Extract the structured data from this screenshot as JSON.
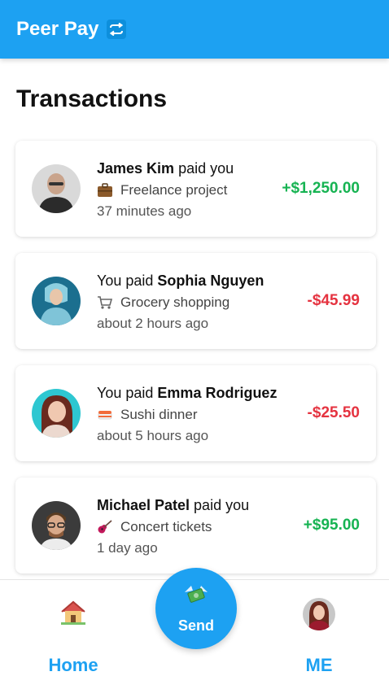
{
  "header": {
    "app_name": "Peer Pay",
    "icon": "swap-arrows-icon",
    "color": "#1da1f2"
  },
  "page": {
    "title": "Transactions"
  },
  "transactions": [
    {
      "prefix": "",
      "name": "James Kim",
      "suffix": " paid you",
      "category_icon": "briefcase-icon",
      "description": "Freelance project",
      "time": "37 minutes ago",
      "amount": "+$1,250.00",
      "amount_color": "#16b352"
    },
    {
      "prefix": "You paid ",
      "name": "Sophia Nguyen",
      "suffix": "",
      "category_icon": "shopping-cart-icon",
      "description": "Grocery shopping",
      "time": "about 2 hours ago",
      "amount": "-$45.99",
      "amount_color": "#e53340"
    },
    {
      "prefix": "You paid ",
      "name": "Emma Rodriguez",
      "suffix": "",
      "category_icon": "sushi-icon",
      "description": "Sushi dinner",
      "time": "about 5 hours ago",
      "amount": "-$25.50",
      "amount_color": "#e53340"
    },
    {
      "prefix": "",
      "name": "Michael Patel",
      "suffix": " paid you",
      "category_icon": "guitar-icon",
      "description": "Concert tickets",
      "time": "1 day ago",
      "amount": "+$95.00",
      "amount_color": "#16b352"
    }
  ],
  "nav": {
    "home_label": "Home",
    "home_icon": "house-icon",
    "send_label": "Send",
    "send_icon": "money-with-wings-icon",
    "me_label": "ME"
  }
}
